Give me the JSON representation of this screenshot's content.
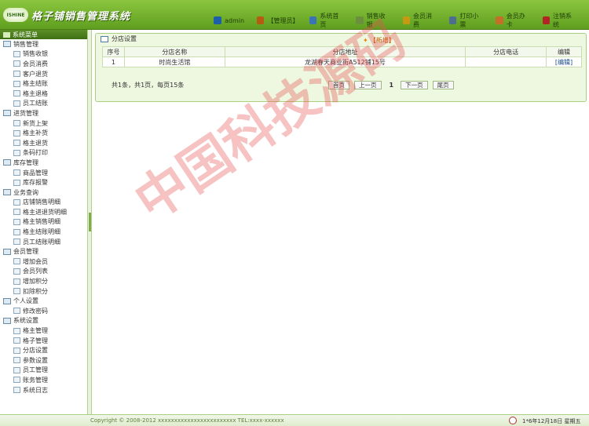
{
  "app": {
    "logo_badge": "ISHINE",
    "title": "格子铺销售管理系统"
  },
  "topnav": [
    {
      "label": "admin",
      "icon": "user-icon",
      "color": "#1c5fa8"
    },
    {
      "label": "【管理员】",
      "icon": "admin-icon",
      "color": "#b65c12"
    },
    {
      "label": "系统首页",
      "icon": "home-icon",
      "color": "#3a74b4"
    },
    {
      "label": "销售收银",
      "icon": "cashier-icon",
      "color": "#6c8f3f"
    },
    {
      "label": "会员消费",
      "icon": "member-icon",
      "color": "#c49a12"
    },
    {
      "label": "打印小票",
      "icon": "printer-icon",
      "color": "#4f6d8f"
    },
    {
      "label": "会员办卡",
      "icon": "card-icon",
      "color": "#c46e2a"
    },
    {
      "label": "注销系统",
      "icon": "logout-icon",
      "color": "#b32525"
    }
  ],
  "sidebar": {
    "title": "系统菜单",
    "groups": [
      {
        "label": "销售管理",
        "items": [
          "销售收银",
          "会员消费",
          "客户退货",
          "格主结账",
          "格主退格",
          "员工结账"
        ]
      },
      {
        "label": "进货管理",
        "items": [
          "新货上架",
          "格主补货",
          "格主退货",
          "条码打印"
        ]
      },
      {
        "label": "库存管理",
        "items": [
          "商品管理",
          "库存报警"
        ]
      },
      {
        "label": "业务查询",
        "items": [
          "店铺销售明细",
          "格主进退货明细",
          "格主销售明细",
          "格主结账明细",
          "员工结账明细"
        ]
      },
      {
        "label": "会员管理",
        "items": [
          "增加会员",
          "会员列表",
          "增加积分",
          "扣除积分"
        ]
      },
      {
        "label": "个人设置",
        "items": [
          "修改密码"
        ]
      },
      {
        "label": "系统设置",
        "items": [
          "格主管理",
          "格子管理",
          "分店设置",
          "参数设置",
          "员工管理",
          "账务管理",
          "系统日志"
        ]
      }
    ]
  },
  "panel": {
    "title": "分店设置",
    "add_label": "【新增】",
    "columns": [
      "序号",
      "分店名称",
      "分店地址",
      "分店电话",
      "编辑"
    ],
    "rows": [
      {
        "no": "1",
        "name": "时尚生活馆",
        "address": "龙湖春天商业街A512铺15号",
        "phone": "",
        "edit": "[编辑]"
      }
    ],
    "pager": {
      "info": "共1条，共1页，每页15条",
      "first": "首页",
      "prev": "上一页",
      "current": "1",
      "next": "下一页",
      "last": "尾页"
    }
  },
  "watermark": "中国科技源码",
  "footer": {
    "copyright": "Copyright © 2008-2012 xxxxxxxxxxxxxxxxxxxxxxxx TEL:xxxx-xxxxxx",
    "date": "1*6年12月18日 星期五"
  }
}
